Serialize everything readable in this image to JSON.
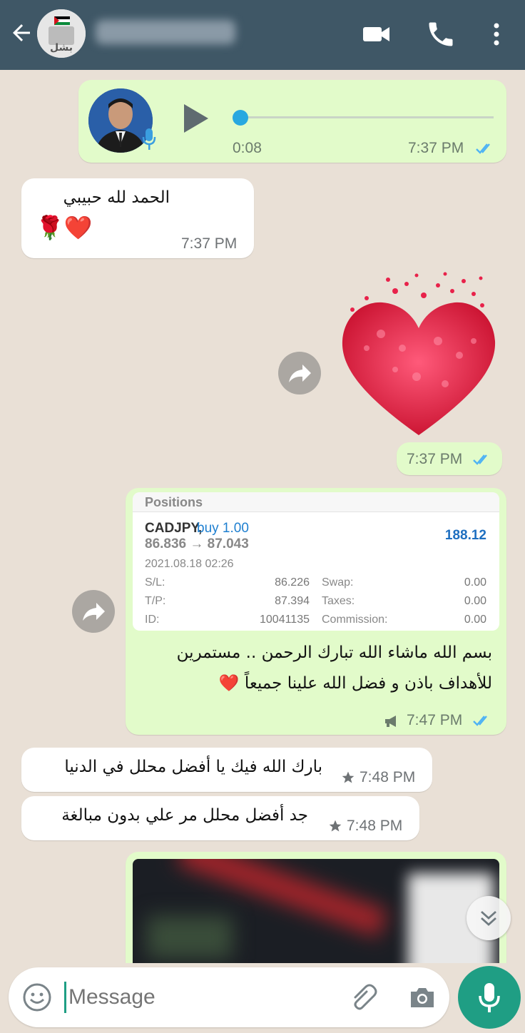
{
  "header": {
    "avatar_text": "بشل",
    "contact_name": ""
  },
  "voice_message": {
    "duration": "0:08",
    "time": "7:37 PM"
  },
  "msg_incoming_1": {
    "line1": "الحمد لله حبيبي",
    "emojis": "🌹❤️",
    "time": "7:37 PM"
  },
  "sticker_message": {
    "time": "7:37 PM"
  },
  "positions_card": {
    "title": "Positions",
    "symbol": "CADJPY,",
    "side": "buy 1.00",
    "price_range": "86.836 → 87.043",
    "profit": "188.12",
    "datetime": "2021.08.18 02:26",
    "sl_label": "S/L:",
    "sl_value": "86.226",
    "tp_label": "T/P:",
    "tp_value": "87.394",
    "id_label": "ID:",
    "id_value": "10041135",
    "swap_label": "Swap:",
    "swap_value": "0.00",
    "taxes_label": "Taxes:",
    "taxes_value": "0.00",
    "commission_label": "Commission:",
    "commission_value": "0.00"
  },
  "msg_outgoing_caption": {
    "line1": "بسم الله ماشاء الله تبارك الرحمن .. مستمرين",
    "line2": "للأهداف باذن و فضل الله علينا جميعاً ❤️",
    "time": "7:47 PM"
  },
  "msg_incoming_2": {
    "text": "بارك الله فيك يا أفضل محلل في الدنيا",
    "time": "7:48 PM"
  },
  "msg_incoming_3": {
    "text": "جد أفضل محلل مر علي بدون مبالغة",
    "time": "7:48 PM"
  },
  "input": {
    "placeholder": "Message"
  },
  "colors": {
    "header": "#3f5766",
    "outgoing_bubble": "#e2fbca",
    "incoming_bubble": "#ffffff",
    "accent": "#1f9e84",
    "read_ticks": "#4fb3f4"
  }
}
